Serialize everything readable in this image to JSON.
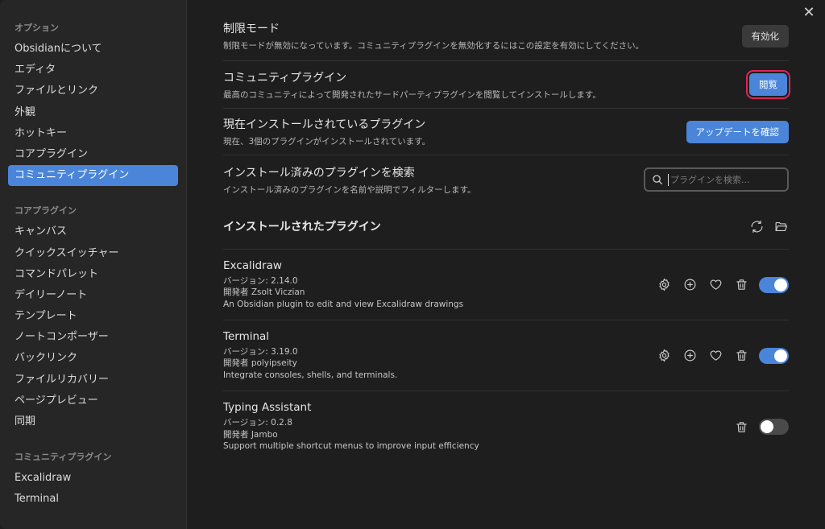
{
  "sidebar": {
    "options_heading": "オプション",
    "options": [
      {
        "label": "Obsidianについて"
      },
      {
        "label": "エディタ"
      },
      {
        "label": "ファイルとリンク"
      },
      {
        "label": "外観"
      },
      {
        "label": "ホットキー"
      },
      {
        "label": "コアプラグイン"
      },
      {
        "label": "コミュニティプラグイン",
        "active": true
      }
    ],
    "core_heading": "コアプラグイン",
    "core": [
      {
        "label": "キャンバス"
      },
      {
        "label": "クイックスイッチャー"
      },
      {
        "label": "コマンドパレット"
      },
      {
        "label": "デイリーノート"
      },
      {
        "label": "テンプレート"
      },
      {
        "label": "ノートコンポーザー"
      },
      {
        "label": "バックリンク"
      },
      {
        "label": "ファイルリカバリー"
      },
      {
        "label": "ページプレビュー"
      },
      {
        "label": "同期"
      }
    ],
    "community_heading": "コミュニティプラグイン",
    "community": [
      {
        "label": "Excalidraw"
      },
      {
        "label": "Terminal"
      }
    ]
  },
  "settings": {
    "restricted": {
      "name": "制限モード",
      "desc": "制限モードが無効になっています。コミュニティプラグインを無効化するにはこの設定を有効にしてください。",
      "button": "有効化"
    },
    "community": {
      "name": "コミュニティプラグイン",
      "desc": "最高のコミュニティによって開発されたサードパーティプラグインを閲覧してインストールします。",
      "button": "閲覧"
    },
    "installed": {
      "name": "現在インストールされているプラグイン",
      "desc": "現在、3個のプラグインがインストールされています。",
      "button": "アップデートを確認"
    },
    "search": {
      "name": "インストール済みのプラグインを検索",
      "desc": "インストール済みのプラグインを名前や説明でフィルターします。",
      "placeholder": "プラグインを検索..."
    }
  },
  "installed_section": {
    "title": "インストールされたプラグイン",
    "icons": [
      "refresh-icon",
      "folder-open-icon"
    ]
  },
  "plugins": [
    {
      "name": "Excalidraw",
      "version": "バージョン: 2.14.0",
      "author": "開発者 Zsolt Viczian",
      "desc": "An Obsidian plugin to edit and view Excalidraw drawings",
      "enabled": true
    },
    {
      "name": "Terminal",
      "version": "バージョン: 3.19.0",
      "author": "開発者 polyipseity",
      "desc": "Integrate consoles, shells, and terminals.",
      "enabled": true
    },
    {
      "name": "Typing Assistant",
      "version": "バージョン: 0.2.8",
      "author": "開発者 Jambo",
      "desc": "Support multiple shortcut menus to improve input efficiency",
      "enabled": false
    }
  ],
  "colors": {
    "accent": "#4a85d9",
    "highlight": "#e0245e",
    "background": "#1e1e1e",
    "sidebar": "#262626"
  },
  "close_icon": "close-icon"
}
